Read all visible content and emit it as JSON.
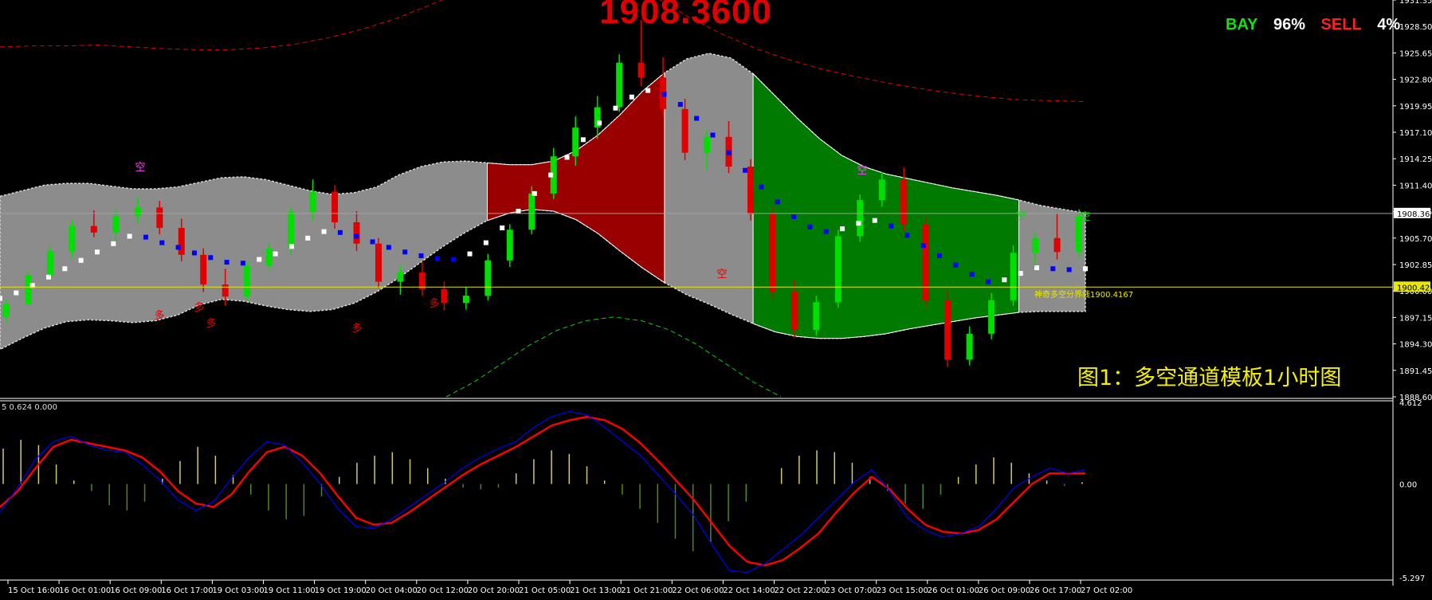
{
  "header": {
    "current_price_big": "1908.3600",
    "buy_label": "BAY",
    "buy_pct": "96%",
    "sell_label": "SELL",
    "sell_pct": "4%"
  },
  "caption": "图1：多空通道模板1小时图",
  "divider_label": "神奇多空分界线1900.4167",
  "osc_header": "5 0.624 0.000",
  "colors": {
    "background": "#000000",
    "band": "#8c8c8c",
    "bull_zone": "#9b0000",
    "bear_zone": "#007a00",
    "bull_candle": "#00e000",
    "bear_candle": "#e00000",
    "midline_up": "#ffffff",
    "midline_down": "#0000ff",
    "divider": "#e8e800",
    "axis_text": "#ffffff"
  },
  "chart_data": [
    {
      "type": "candlestick",
      "title": "",
      "y_ticks": [
        "1931.35",
        "1928.50",
        "1925.65",
        "1922.80",
        "1919.95",
        "1917.10",
        "1914.25",
        "1911.40",
        "1908.55",
        "1905.70",
        "1902.85",
        "1900.00",
        "1897.15",
        "1894.30",
        "1891.45",
        "1888.60"
      ],
      "ylim": [
        1888.6,
        1931.35
      ],
      "current_price_tag": "1908.36",
      "divider_tag": "1900.42",
      "x_ticks": [
        "15 Oct 16:00",
        "16 Oct 01:00",
        "16 Oct 09:00",
        "16 Oct 17:00",
        "19 Oct 03:00",
        "19 Oct 11:00",
        "19 Oct 19:00",
        "20 Oct 04:00",
        "20 Oct 12:00",
        "20 Oct 20:00",
        "21 Oct 05:00",
        "21 Oct 13:00",
        "21 Oct 21:00",
        "22 Oct 06:00",
        "22 Oct 14:00",
        "22 Oct 22:00",
        "23 Oct 07:00",
        "23 Oct 15:00",
        "26 Oct 01:00",
        "26 Oct 09:00",
        "26 Oct 17:00",
        "27 Oct 02:00"
      ],
      "markers": [
        "多",
        "多",
        "多",
        "多",
        "多",
        "空",
        "空",
        "空",
        "空",
        "空"
      ],
      "midline": [
        1899.2,
        1899.8,
        1900.6,
        1901.5,
        1902.4,
        1903.3,
        1904.2,
        1905.1,
        1905.9,
        1905.8,
        1905.2,
        1904.7,
        1904.1,
        1903.6,
        1903.1,
        1903.0,
        1903.4,
        1904.0,
        1904.8,
        1905.7,
        1906.4,
        1906.3,
        1905.9,
        1905.3,
        1904.7,
        1904.2,
        1903.8,
        1903.5,
        1903.4,
        1904.0,
        1905.2,
        1906.8,
        1908.6,
        1910.5,
        1912.5,
        1914.4,
        1916.3,
        1918.1,
        1919.7,
        1920.9,
        1921.6,
        1921.2,
        1920.1,
        1918.6,
        1916.8,
        1914.9,
        1913.0,
        1911.2,
        1909.6,
        1908.0,
        1906.9,
        1906.4,
        1906.7,
        1907.3,
        1907.6,
        1907.0,
        1906.0,
        1904.9,
        1903.8,
        1902.8,
        1901.8,
        1901.0,
        1901.2,
        1901.9,
        1902.5,
        1902.4,
        1902.3,
        1902.4
      ],
      "upper_band": [
        1910.2,
        1910.8,
        1911.4,
        1911.6,
        1911.6,
        1911.3,
        1911.0,
        1911.0,
        1911.2,
        1911.7,
        1912.2,
        1912.3,
        1912.0,
        1911.4,
        1910.8,
        1910.4,
        1910.6,
        1911.2,
        1912.5,
        1913.4,
        1913.9,
        1914.0,
        1913.8,
        1913.6,
        1913.6,
        1914.0,
        1915.1,
        1916.8,
        1919.0,
        1921.5,
        1923.5,
        1925.0,
        1925.6,
        1925.1,
        1923.4,
        1921.0,
        1918.6,
        1916.4,
        1914.6,
        1913.4,
        1912.6,
        1912.1,
        1911.6,
        1911.1,
        1910.7,
        1910.3,
        1909.8,
        1909.2,
        1908.8,
        1908.4
      ],
      "lower_band": [
        1893.7,
        1894.9,
        1896.0,
        1896.7,
        1896.9,
        1896.8,
        1896.6,
        1896.8,
        1897.4,
        1898.5,
        1899.1,
        1898.9,
        1898.4,
        1898.0,
        1897.8,
        1898.0,
        1898.7,
        1899.9,
        1901.4,
        1903.1,
        1904.8,
        1906.3,
        1907.6,
        1908.4,
        1908.8,
        1908.6,
        1907.7,
        1906.2,
        1904.3,
        1902.5,
        1900.9,
        1899.6,
        1898.6,
        1897.5,
        1896.5,
        1895.6,
        1895.1,
        1894.9,
        1894.9,
        1895.1,
        1895.4,
        1895.9,
        1896.3,
        1896.7,
        1897.1,
        1897.4,
        1897.7,
        1897.8,
        1897.8,
        1897.8
      ],
      "candles": [
        [
          1897.2,
          1899.1,
          1896.6,
          1898.6
        ],
        [
          1898.6,
          1902.2,
          1898.4,
          1901.7
        ],
        [
          1901.7,
          1904.8,
          1901.2,
          1904.3
        ],
        [
          1904.3,
          1907.6,
          1903.6,
          1907.0
        ],
        [
          1907.0,
          1908.7,
          1905.8,
          1906.3
        ],
        [
          1906.3,
          1908.9,
          1905.3,
          1908.1
        ],
        [
          1908.1,
          1910.1,
          1907.3,
          1909.0
        ],
        [
          1909.0,
          1909.7,
          1906.1,
          1906.8
        ],
        [
          1906.8,
          1907.8,
          1903.2,
          1903.9
        ],
        [
          1903.9,
          1904.6,
          1899.9,
          1900.7
        ],
        [
          1900.7,
          1902.4,
          1898.4,
          1899.4
        ],
        [
          1899.4,
          1903.2,
          1898.9,
          1902.7
        ],
        [
          1902.7,
          1905.3,
          1902.1,
          1904.6
        ],
        [
          1904.6,
          1909.1,
          1903.9,
          1908.5
        ],
        [
          1908.5,
          1912.0,
          1907.6,
          1910.7
        ],
        [
          1910.7,
          1911.4,
          1906.7,
          1907.4
        ],
        [
          1907.4,
          1908.6,
          1904.3,
          1905.1
        ],
        [
          1905.1,
          1905.7,
          1900.3,
          1901.0
        ],
        [
          1901.0,
          1902.7,
          1899.6,
          1902.0
        ],
        [
          1902.0,
          1903.2,
          1899.5,
          1900.2
        ],
        [
          1900.2,
          1901.0,
          1897.9,
          1898.7
        ],
        [
          1898.7,
          1900.4,
          1898.0,
          1899.5
        ],
        [
          1899.5,
          1904.0,
          1899.0,
          1903.3
        ],
        [
          1903.3,
          1907.2,
          1902.6,
          1906.6
        ],
        [
          1906.6,
          1911.3,
          1906.1,
          1910.5
        ],
        [
          1910.5,
          1915.4,
          1909.9,
          1914.5
        ],
        [
          1914.5,
          1918.8,
          1913.5,
          1917.6
        ],
        [
          1917.6,
          1921.0,
          1916.4,
          1919.8
        ],
        [
          1919.8,
          1925.5,
          1919.3,
          1924.6
        ],
        [
          1924.6,
          1929.2,
          1922.1,
          1923.0
        ],
        [
          1923.0,
          1925.2,
          1918.8,
          1919.6
        ],
        [
          1919.6,
          1920.7,
          1914.1,
          1914.9
        ],
        [
          1914.9,
          1917.4,
          1913.0,
          1916.6
        ],
        [
          1916.6,
          1918.3,
          1912.7,
          1913.4
        ],
        [
          1913.4,
          1914.2,
          1907.6,
          1908.3
        ],
        [
          1908.3,
          1909.1,
          1899.1,
          1899.9
        ],
        [
          1899.9,
          1901.2,
          1895.0,
          1895.8
        ],
        [
          1895.8,
          1899.5,
          1895.2,
          1898.8
        ],
        [
          1898.8,
          1906.6,
          1898.2,
          1905.9
        ],
        [
          1905.9,
          1910.4,
          1905.3,
          1909.8
        ],
        [
          1909.8,
          1912.8,
          1909.1,
          1912.0
        ],
        [
          1912.0,
          1913.3,
          1906.5,
          1907.2
        ],
        [
          1907.2,
          1908.0,
          1898.2,
          1899.0
        ],
        [
          1899.0,
          1900.1,
          1891.8,
          1892.6
        ],
        [
          1892.6,
          1896.2,
          1892.0,
          1895.4
        ],
        [
          1895.4,
          1899.8,
          1894.8,
          1899.0
        ],
        [
          1899.0,
          1904.9,
          1898.4,
          1904.1
        ],
        [
          1904.1,
          1906.4,
          1902.5,
          1905.7
        ],
        [
          1905.7,
          1908.3,
          1903.4,
          1904.2
        ],
        [
          1904.2,
          1908.8,
          1903.6,
          1908.0
        ]
      ],
      "upper_outer_dashed": [
        1926.3,
        1926.4,
        1926.4,
        1926.5,
        1926.3,
        1926.1,
        1926.0,
        1926.0,
        1926.2,
        1926.6,
        1927.3,
        1928.2,
        1929.3,
        1930.7,
        1932.2,
        1933.6,
        1934.6,
        1935.0,
        1934.6,
        1933.3,
        1931.5,
        1929.4,
        1927.6,
        1926.1,
        1924.9,
        1923.9,
        1923.1,
        1922.4,
        1921.8,
        1921.3,
        1920.9,
        1920.6,
        1920.5,
        1920.4
      ],
      "lower_outer_dashed": [
        1888.6,
        1890.2,
        1892.2,
        1894.2,
        1895.8,
        1896.8,
        1897.2,
        1896.8,
        1895.8,
        1894.2,
        1892.2,
        1890.2,
        1888.6
      ]
    },
    {
      "type": "oscillator",
      "title": "",
      "y_ticks": [
        "4.612",
        "0.00",
        "-5.297"
      ],
      "ylim": [
        -5.297,
        4.612
      ],
      "series": [
        {
          "color": "#ff0000",
          "values": [
            -1.3,
            -0.4,
            0.9,
            2.1,
            2.5,
            2.3,
            2.1,
            1.9,
            1.5,
            0.7,
            -0.4,
            -1.1,
            -1.3,
            -0.6,
            0.7,
            1.8,
            2.1,
            1.6,
            0.6,
            -0.7,
            -1.9,
            -2.3,
            -2.2,
            -1.6,
            -0.9,
            -0.2,
            0.5,
            1.1,
            1.6,
            2.1,
            2.7,
            3.3,
            3.6,
            3.8,
            3.6,
            3.1,
            2.3,
            1.3,
            0.2,
            -0.9,
            -2.2,
            -3.5,
            -4.4,
            -4.6,
            -4.3,
            -3.6,
            -2.8,
            -1.6,
            -0.5,
            0.4,
            -0.3,
            -1.4,
            -2.3,
            -2.7,
            -2.8,
            -2.6,
            -2.0,
            -1.0,
            0.0,
            0.6,
            0.6,
            0.6
          ]
        },
        {
          "color": "#0000ff",
          "values": [
            -1.6,
            -0.2,
            1.4,
            2.4,
            2.7,
            2.2,
            1.9,
            1.8,
            1.1,
            0.2,
            -0.9,
            -1.5,
            -1.0,
            0.3,
            1.5,
            2.4,
            2.2,
            1.2,
            0.0,
            -1.4,
            -2.4,
            -2.5,
            -2.0,
            -1.3,
            -0.6,
            0.1,
            0.9,
            1.5,
            2.0,
            2.4,
            3.2,
            3.8,
            4.1,
            3.9,
            3.2,
            2.4,
            1.6,
            0.5,
            -0.6,
            -1.8,
            -3.4,
            -4.9,
            -5.0,
            -4.5,
            -3.7,
            -2.9,
            -1.9,
            -0.9,
            0.1,
            0.8,
            -0.4,
            -1.9,
            -2.6,
            -3.0,
            -2.8,
            -2.4,
            -1.4,
            -0.2,
            0.4,
            0.9,
            0.6,
            0.8
          ]
        },
        {
          "color": "#d4c870",
          "values": [
            2.0,
            2.5,
            2.2,
            1.1,
            0.2,
            -0.4,
            -1.2,
            -1.5,
            -1.0,
            0.3,
            1.3,
            2.1,
            1.6,
            0.5,
            -0.6,
            -1.5,
            -2.0,
            -1.8,
            -0.7,
            0.4,
            1.2,
            1.6,
            1.8,
            1.4,
            0.9,
            0.3,
            -0.2,
            -0.3,
            -0.2,
            0.6,
            1.4,
            1.9,
            1.7,
            1.0,
            0.2,
            -0.6,
            -1.4,
            -2.2,
            -3.1,
            -3.8,
            -3.3,
            -2.1,
            -1.0,
            0.0,
            0.9,
            1.6,
            1.9,
            1.8,
            1.2,
            0.4,
            -0.4,
            -1.1,
            -1.4,
            -0.6,
            0.4,
            1.1,
            1.5,
            1.2,
            0.6,
            0.2,
            -0.1,
            0.1
          ]
        }
      ]
    }
  ]
}
